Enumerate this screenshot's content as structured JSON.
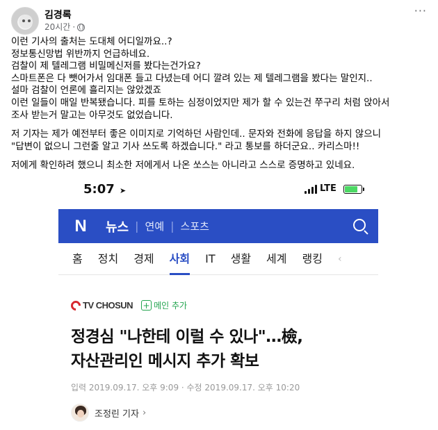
{
  "post": {
    "author": "김경록",
    "time": "20시간",
    "more_label": "···",
    "paragraphs": [
      [
        "이런 기사의 출처는 도대체 어디일까요..?",
        "정보통신망법 위반까지 언급하네요.",
        "검찰이 제 텔레그램 비밀메신저를 봤다는건가요?",
        "스마트폰은 다 뺏어가서 임대폰 들고 다녔는데 어디 깔려 있는 제 텔레그램을 봤다는 말인지..",
        "설마 검찰이 언론에 흘리지는 않았겠죠",
        "이런 일들이 매일 반복됐습니다. 피를 토하는 심정이었지만 제가 할 수 있는건 쭈구리 처럼 앉아서",
        "조사 받는거 말고는 아무것도 없었습니다."
      ],
      [
        "저 기자는 제가 예전부터 좋은 이미지로 기억하던 사람인데.. 문자와 전화에 응답을 하지 않으니",
        "\"답변이 없으니 그런줄 알고 기사 쓰도록 하겠습니다.\" 라고 통보를 하더군요.. 카리스마!!"
      ],
      [
        "저에게 확인하려 했으니 최소한 저에게서 나온 쏘스는 아니라고 스스로 증명하고 있네요."
      ]
    ]
  },
  "screenshot": {
    "status": {
      "time": "5:07",
      "network": "LTE",
      "battery_level": 0.8
    },
    "app_bar": {
      "logo": "N",
      "main": "뉴스",
      "subs": [
        "연예",
        "스포츠"
      ]
    },
    "tabs": [
      {
        "label": "홈",
        "active": false
      },
      {
        "label": "정치",
        "active": false
      },
      {
        "label": "경제",
        "active": false
      },
      {
        "label": "사회",
        "active": true
      },
      {
        "label": "IT",
        "active": false
      },
      {
        "label": "생활",
        "active": false
      },
      {
        "label": "세계",
        "active": false
      },
      {
        "label": "랭킹",
        "active": false
      }
    ],
    "press": {
      "name": "TV CHOSUN",
      "subscribe_label": "메인 추가",
      "subscribe_plus": "+"
    },
    "headline": [
      "정경심 \"나한테 이럴 수 있나\"…檢,",
      "자산관리인 메시지 추가 확보"
    ],
    "dates": "입력 2019.09.17. 오후 9:09 · 수정 2019.09.17. 오후 10:20",
    "reporter": {
      "name": "조정린 기자",
      "chevron": "›"
    }
  },
  "icons": {
    "avatar": "profile-photo",
    "globe": "globe-icon",
    "location": "location-arrow-icon",
    "search": "search-icon"
  },
  "colors": {
    "naver_blue": "#2a4ec4",
    "active_tab": "#2a4ec4",
    "subscribe_green": "#23a44f",
    "press_red": "#d7282f",
    "battery_green": "#4cd964"
  }
}
